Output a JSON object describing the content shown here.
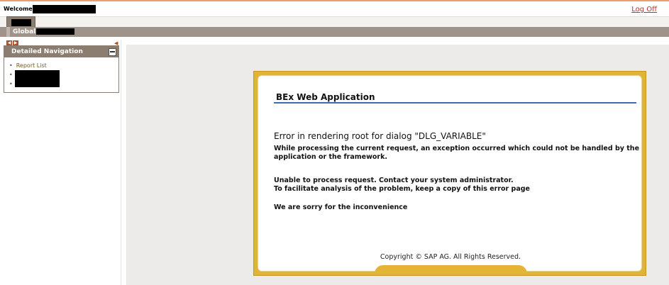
{
  "header": {
    "welcome_label": "Welcome",
    "logoff_label": "Log Off"
  },
  "tabs": {
    "global_label": "Global"
  },
  "navigation": {
    "title": "Detailed Navigation",
    "items": [
      {
        "label": "Report List"
      }
    ]
  },
  "dialog": {
    "title": "BEx Web Application",
    "error_main": "Error in rendering root for dialog \"DLG_VARIABLE\"",
    "error_detail_1": "While processing the current request, an exception occurred which could not be handled by the",
    "error_detail_2": "application or the framework.",
    "unable_1": "Unable to process request. Contact your system administrator.",
    "unable_2": "To facilitate analysis of the problem, keep a copy of this error page",
    "sorry": "We are sorry for the inconvenience",
    "copyright": "Copyright © SAP AG. All Rights Reserved."
  },
  "colors": {
    "accent_brown": "#8b7d6f",
    "dialog_gold": "#e0b437",
    "title_rule_blue": "#3a6fb0",
    "logoff_red": "#b5332a"
  },
  "icons": [
    "nav-back-icon",
    "nav-forward-icon",
    "collapse-icon",
    "minimize-icon"
  ]
}
